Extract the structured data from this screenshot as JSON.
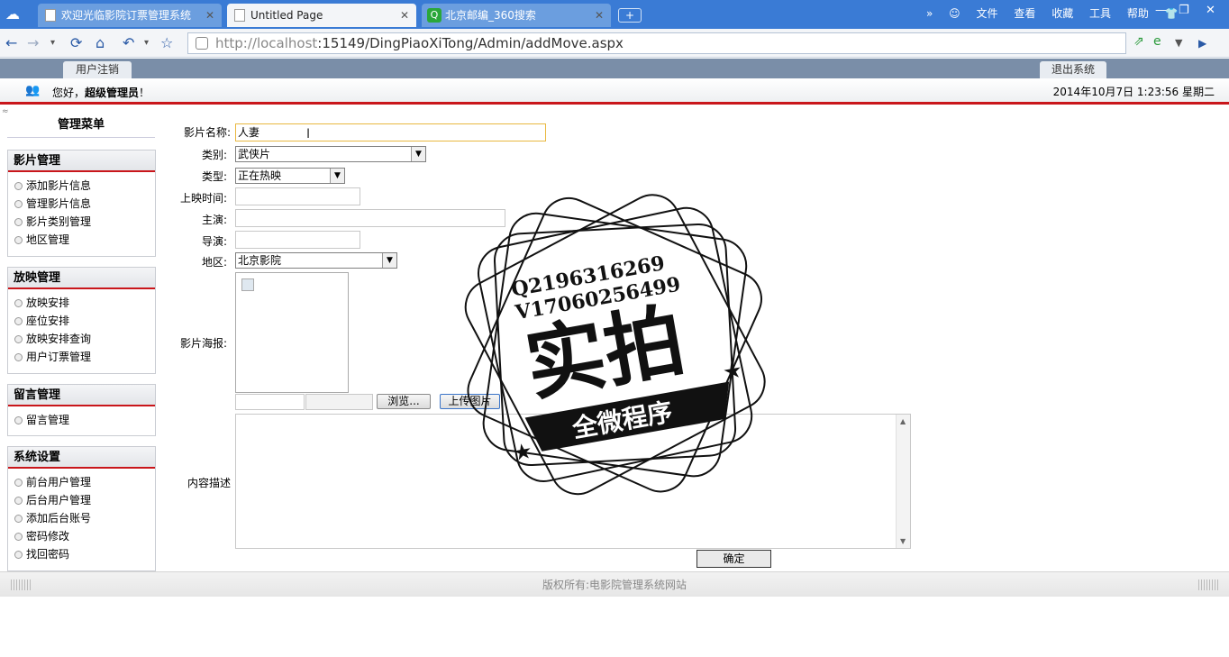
{
  "browser": {
    "tabs": [
      {
        "label": "欢迎光临影院订票管理系统",
        "close": "✕"
      },
      {
        "label": "Untitled Page",
        "close": "✕"
      },
      {
        "label": "北京邮编_360搜索",
        "close": "✕"
      }
    ],
    "menu": [
      "文件",
      "查看",
      "收藏",
      "工具",
      "帮助"
    ],
    "url_host": "http://localhost",
    "url_rest": ":15149/DingPiaoXiTong/Admin/addMove.aspx"
  },
  "header": {
    "logout_label": "用户注销",
    "exit_label": "退出系统",
    "greeting_prefix": "您好，",
    "greeting_user": "超级管理员",
    "greeting_suffix": "！",
    "datetime": "2014年10月7日 1:23:56 星期二"
  },
  "sidebar": {
    "title": "管理菜单",
    "groups": [
      {
        "title": "影片管理",
        "items": [
          "添加影片信息",
          "管理影片信息",
          "影片类别管理",
          "地区管理"
        ]
      },
      {
        "title": "放映管理",
        "items": [
          "放映安排",
          "座位安排",
          "放映安排查询",
          "用户订票管理"
        ]
      },
      {
        "title": "留言管理",
        "items": [
          "留言管理"
        ]
      },
      {
        "title": "系统设置",
        "items": [
          "前台用户管理",
          "后台用户管理",
          "添加后台账号",
          "密码修改",
          "找回密码"
        ]
      }
    ]
  },
  "form": {
    "name_label": "影片名称:",
    "name_value": "人妻",
    "category_label": "类别:",
    "category_value": "武侠片",
    "type_label": "类型:",
    "type_value": "正在热映",
    "release_label": "上映时间:",
    "actor_label": "主演:",
    "director_label": "导演:",
    "region_label": "地区:",
    "region_value": "北京影院",
    "poster_label": "影片海报:",
    "browse_label": "浏览...",
    "upload_label": "上传图片",
    "desc_label": "内容描述",
    "submit_label": "确定"
  },
  "footer": {
    "text": "版权所有:电影院管理系统网站"
  },
  "watermark": {
    "line1": "Q2196316269",
    "line2": "V17060256499",
    "main": "实拍",
    "banner": "全微程序"
  }
}
